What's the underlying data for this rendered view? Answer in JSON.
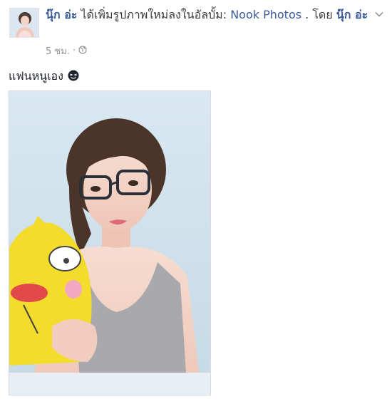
{
  "post": {
    "author_name": "นุ๊ก อ่ะ",
    "action_text": " ได้เพิ่มรูปภาพใหม่ลงในอัลบั้ม: ",
    "album_name": "Nook Photos",
    "by_text": " . โดย ",
    "by_author": "นุ๊ก อ่ะ",
    "timestamp": "5 ชม.",
    "separator": "·",
    "privacy_icon": "globe-icon",
    "caption": "แฟนหนูเอง",
    "caption_emoji": "squinting-face-icon"
  },
  "colors": {
    "link": "#3b5998",
    "meta": "#90949c",
    "photo_bg": "#cfe1ec"
  }
}
